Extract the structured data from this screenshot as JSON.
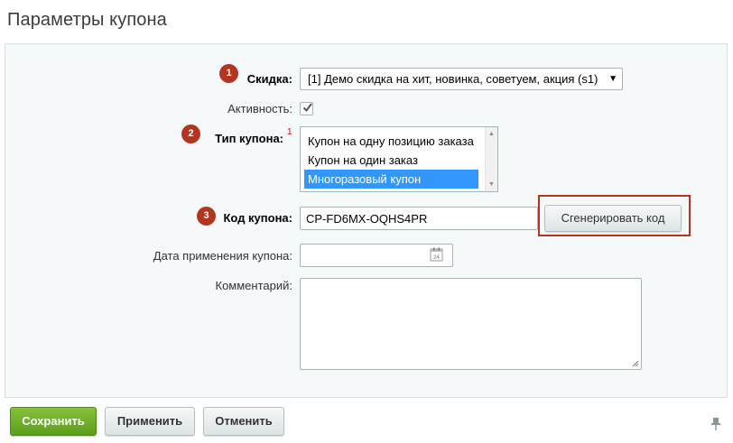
{
  "page": {
    "title": "Параметры купона"
  },
  "form": {
    "discount": {
      "marker": "1",
      "label": "Скидка:",
      "value": "[1] Демо скидка на хит, новинка, советуем, акция (s1)",
      "arrow": "▼"
    },
    "activity": {
      "label": "Активность:",
      "checked": true
    },
    "coupon_type": {
      "marker": "2",
      "label": "Тип купона:",
      "required_mark": "1",
      "options": [
        "Купон на одну позицию заказа",
        "Купон на один заказ",
        "Многоразовый купон"
      ],
      "selected_index": 2,
      "scroll_up": "▲",
      "scroll_down": "▼"
    },
    "coupon_code": {
      "marker": "3",
      "label": "Код купона:",
      "value": "CP-FD6MX-OQHS4PR",
      "generate_label": "Сгенерировать код"
    },
    "apply_date": {
      "label": "Дата применения купона:",
      "value": "",
      "icon": "calendar-icon",
      "icon_text": "24"
    },
    "comment": {
      "label": "Комментарий:",
      "value": ""
    }
  },
  "footer": {
    "save_label": "Сохранить",
    "apply_label": "Применить",
    "cancel_label": "Отменить",
    "pin_icon": "pin-icon"
  },
  "colors": {
    "marker": "#b3341f",
    "selected": "#3297fd",
    "save_green": "#6aab24",
    "panel_bg": "#f5f9f9"
  }
}
